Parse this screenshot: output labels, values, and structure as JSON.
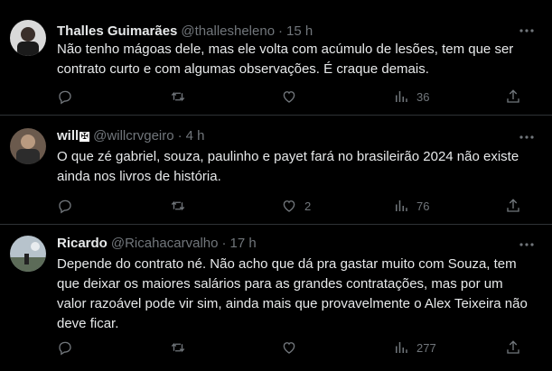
{
  "tweets": [
    {
      "name": "Thalles Guimarães",
      "handle": "@thallesheleno",
      "sep": "·",
      "time": "15 h",
      "text": "Não tenho mágoas dele, mas ele volta com acúmulo de lesões, tem que ser contrato curto e com algumas observações. É craque demais.",
      "reply_count": "",
      "retweet_count": "",
      "like_count": "",
      "view_count": "36"
    },
    {
      "name": "will",
      "name_badge": "✠",
      "handle": "@willcrvgeiro",
      "sep": "·",
      "time": "4 h",
      "text": "O que zé gabriel, souza, paulinho e payet fará no brasileirão 2024 não existe ainda nos livros de história.",
      "reply_count": "",
      "retweet_count": "",
      "like_count": "2",
      "view_count": "76"
    },
    {
      "name": "Ricardo",
      "handle": "@Ricahacarvalho",
      "sep": "·",
      "time": "17 h",
      "text": "Depende do contrato né. Não acho que dá pra gastar muito com Souza, tem que deixar os maiores salários para as grandes contratações, mas por um valor razoável pode vir sim, ainda mais que provavelmente o Alex Teixeira não deve ficar.",
      "reply_count": "",
      "retweet_count": "",
      "like_count": "",
      "view_count": "277"
    }
  ],
  "colors": {
    "background": "#000000",
    "text": "#e7e9ea",
    "secondary": "#71767b",
    "divider": "#2f3336"
  }
}
